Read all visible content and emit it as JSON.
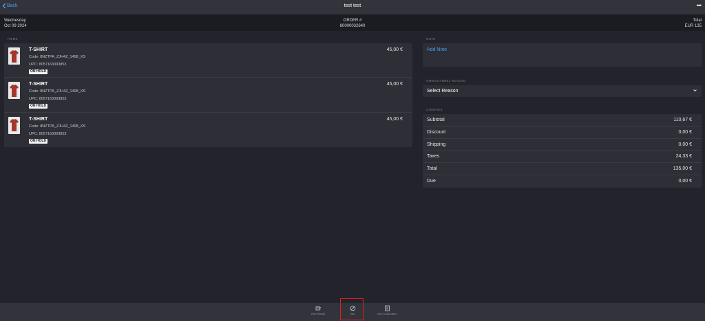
{
  "header": {
    "back_label": "Back",
    "title": "test test",
    "more_label": "•••"
  },
  "info": {
    "day": "Wednesday",
    "date": "Oct 09 2024",
    "order_label": "ORDER #",
    "order_number": "80000032640",
    "total_label": "Total",
    "total_value": "EUR 135"
  },
  "items_section": {
    "label": "ITEMS",
    "items": [
      {
        "name": "T-SHIRT",
        "code": "Code: 8NZTPA_ZJH4Z_1498_XS",
        "upc": "UPC: 8057163093853",
        "status": "ON HOLD",
        "price": "45,00 €"
      },
      {
        "name": "T-SHIRT",
        "code": "Code: 8NZTPA_ZJH4Z_1498_XS",
        "upc": "UPC: 8057163093853",
        "status": "ON HOLD",
        "price": "45,00 €"
      },
      {
        "name": "T-SHIRT",
        "code": "Code: 8NZTPA_ZJH4Z_1498_XS",
        "upc": "UPC: 8057163093853",
        "status": "ON HOLD",
        "price": "45,00 €"
      }
    ]
  },
  "note": {
    "label": "NOTE",
    "add_label": "Add Note"
  },
  "reason": {
    "label": "OMNICHANNEL REASON",
    "value": "Select Reason"
  },
  "charges": {
    "label": "CHARGES",
    "rows": [
      {
        "label": "Subtotal",
        "value": "110,67 €"
      },
      {
        "label": "Discount",
        "value": "0,00 €"
      },
      {
        "label": "Shipping",
        "value": "0,00 €"
      },
      {
        "label": "Taxes",
        "value": "24,33 €"
      },
      {
        "label": "Total",
        "value": "135,00 €"
      },
      {
        "label": "Due",
        "value": "0,00 €"
      }
    ]
  },
  "bottom_actions": {
    "print_receipt": "Print Receipt",
    "void": "Void",
    "view_confirmation": "View Confirmation"
  },
  "colors": {
    "accent": "#4c9bf0",
    "highlight": "#e0221c",
    "product": "#a3372b"
  }
}
